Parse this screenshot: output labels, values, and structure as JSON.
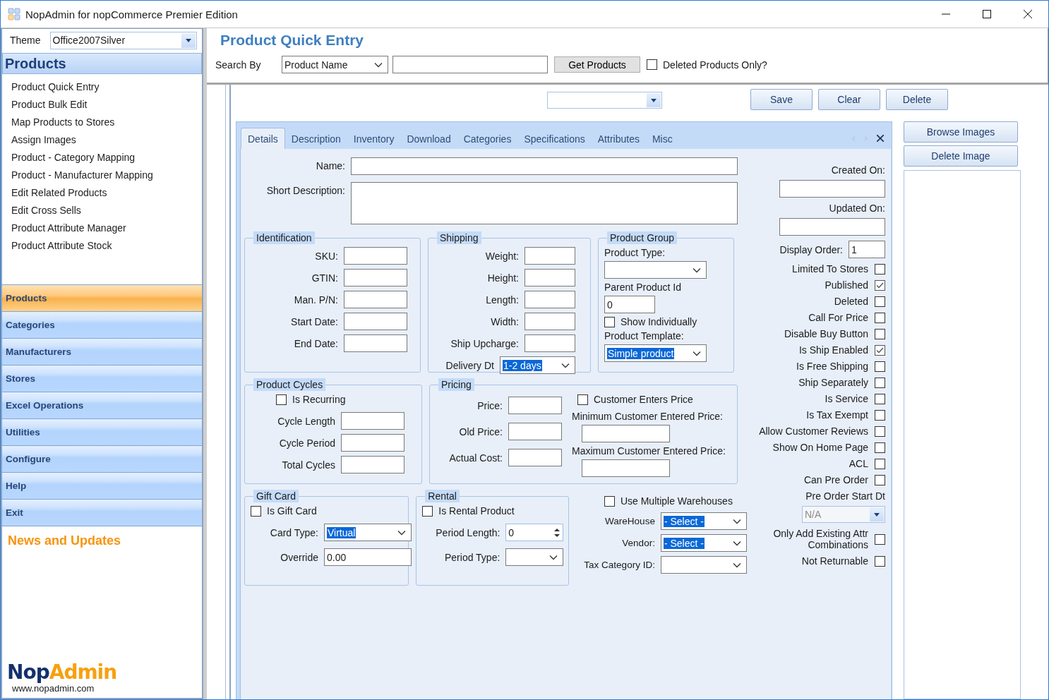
{
  "window": {
    "title": "NopAdmin for nopCommerce Premier Edition"
  },
  "sidebar": {
    "theme_label": "Theme",
    "theme": {
      "kind": "combo",
      "value": "Office2007Silver"
    },
    "section_title": "Products",
    "items": [
      {
        "label": "Product Quick Entry"
      },
      {
        "label": "Product Bulk Edit"
      },
      {
        "label": "Map Products to Stores"
      },
      {
        "label": "Assign Images"
      },
      {
        "label": "Product - Category Mapping"
      },
      {
        "label": "Product - Manufacturer Mapping"
      },
      {
        "label": "Edit Related Products"
      },
      {
        "label": "Edit Cross Sells"
      },
      {
        "label": "Product Attribute Manager"
      },
      {
        "label": "Product Attribute Stock"
      }
    ],
    "nav": [
      {
        "label": "Products",
        "selected": true
      },
      {
        "label": "Categories",
        "selected": false
      },
      {
        "label": "Manufacturers",
        "selected": false
      },
      {
        "label": "Stores",
        "selected": false
      },
      {
        "label": "Excel Operations",
        "selected": false
      },
      {
        "label": "Utilities",
        "selected": false
      },
      {
        "label": "Configure",
        "selected": false
      },
      {
        "label": "Help",
        "selected": false
      },
      {
        "label": "Exit",
        "selected": false
      }
    ],
    "news_title": "News and Updates",
    "logo": {
      "word_parts": [
        "Nop",
        "Admin"
      ],
      "url": "www.nopadmin.com"
    }
  },
  "header": {
    "title": "Product Quick Entry",
    "search_label": "Search By",
    "search_by": {
      "kind": "select",
      "value": "Product Name"
    },
    "search_text": {
      "kind": "text"
    },
    "get_button": "Get Products",
    "deleted_only": {
      "kind": "check",
      "label": "Deleted Products Only?",
      "checked": false
    }
  },
  "toolbar": {
    "selector": {
      "kind": "combo"
    },
    "buttons": [
      "Save",
      "Clear",
      "Delete"
    ]
  },
  "tabs": [
    {
      "label": "Details",
      "selected": true
    },
    {
      "label": "Description",
      "selected": false
    },
    {
      "label": "Inventory",
      "selected": false
    },
    {
      "label": "Download",
      "selected": false
    },
    {
      "label": "Categories",
      "selected": false
    },
    {
      "label": "Specifications",
      "selected": false
    },
    {
      "label": "Attributes",
      "selected": false
    },
    {
      "label": "Misc",
      "selected": false
    }
  ],
  "details": {
    "fields": [
      {
        "kind": "text",
        "label": "Name:",
        "label_above": false
      },
      {
        "kind": "area",
        "label": "Short Description:",
        "label_above": false
      }
    ],
    "group_rows": [
      [
        {
          "kind": "frame",
          "title": "Identification",
          "columns": [
            {
              "fields": [
                {
                  "kind": "text",
                  "label": "SKU:",
                  "label_above": false
                },
                {
                  "kind": "text",
                  "label": "GTIN:",
                  "label_above": false
                },
                {
                  "kind": "text",
                  "label": "Man. P/N:",
                  "label_above": false
                },
                {
                  "kind": "text",
                  "label": "Start Date:",
                  "label_above": false
                },
                {
                  "kind": "text",
                  "label": "End Date:",
                  "label_above": false
                }
              ]
            }
          ]
        },
        {
          "kind": "frame",
          "title": "Shipping",
          "columns": [
            {
              "fields": [
                {
                  "kind": "text",
                  "label": "Weight:",
                  "label_above": false
                },
                {
                  "kind": "text",
                  "label": "Height:",
                  "label_above": false
                },
                {
                  "kind": "text",
                  "label": "Length:",
                  "label_above": false
                },
                {
                  "kind": "text",
                  "label": "Width:",
                  "label_above": false
                },
                {
                  "kind": "text",
                  "label": "Ship Upcharge:",
                  "label_above": false
                },
                {
                  "kind": "select",
                  "label": "Delivery Dt",
                  "label_above": false,
                  "value": "1-2 days",
                  "highlight": true
                }
              ]
            }
          ]
        },
        {
          "kind": "frame",
          "title": "Product Group",
          "columns": [
            {
              "fields": [
                {
                  "kind": "select",
                  "label": "Product Type:",
                  "label_above": true
                },
                {
                  "kind": "text",
                  "label": "Parent Product Id",
                  "label_above": true,
                  "value": "0"
                },
                {
                  "kind": "check",
                  "label": "Show Individually",
                  "checked": false
                },
                {
                  "kind": "select",
                  "label": "Product Template:",
                  "label_above": true,
                  "value": "Simple product",
                  "highlight": true
                }
              ]
            }
          ]
        }
      ],
      [
        {
          "kind": "frame",
          "title": "Product Cycles",
          "columns": [
            {
              "fields": [
                {
                  "kind": "check",
                  "label": "Is Recurring",
                  "checked": false
                },
                {
                  "kind": "text",
                  "label": "Cycle Length",
                  "label_above": false
                },
                {
                  "kind": "text",
                  "label": "Cycle Period",
                  "label_above": false
                },
                {
                  "kind": "text",
                  "label": "Total Cycles",
                  "label_above": false
                }
              ]
            }
          ]
        },
        {
          "kind": "frame",
          "title": "Pricing",
          "columns": [
            {
              "fields": [
                {
                  "kind": "text",
                  "label": "Price:",
                  "label_above": false
                },
                {
                  "kind": "text",
                  "label": "Old Price:",
                  "label_above": false
                },
                {
                  "kind": "text",
                  "label": "Actual Cost:",
                  "label_above": false
                }
              ]
            },
            {
              "fields": [
                {
                  "kind": "check",
                  "label": "Customer Enters Price",
                  "checked": false
                },
                {
                  "kind": "text",
                  "label": "Minimum Customer Entered Price:",
                  "label_above": true
                },
                {
                  "kind": "text",
                  "label": "Maximum Customer Entered Price:",
                  "label_above": true
                }
              ]
            }
          ]
        }
      ],
      [
        {
          "kind": "frame",
          "title": "Gift Card",
          "columns": [
            {
              "fields": [
                {
                  "kind": "check",
                  "label": "Is Gift Card",
                  "checked": false
                },
                {
                  "kind": "select",
                  "label": "Card Type:",
                  "label_above": false,
                  "value": "Virtual",
                  "highlight": true
                },
                {
                  "kind": "text",
                  "label": "Override",
                  "label_above": false,
                  "value": "0.00"
                }
              ]
            }
          ]
        },
        {
          "kind": "frame",
          "title": "Rental",
          "columns": [
            {
              "fields": [
                {
                  "kind": "check",
                  "label": "Is Rental Product",
                  "checked": false
                },
                {
                  "kind": "spin",
                  "label": "Period Length:",
                  "label_above": false,
                  "value": "0"
                },
                {
                  "kind": "select",
                  "label": "Period Type:",
                  "label_above": false
                }
              ]
            }
          ]
        },
        {
          "kind": "plain",
          "columns": [
            {
              "fields": [
                {
                  "kind": "check",
                  "label": "Use Multiple Warehouses",
                  "checked": false
                },
                {
                  "kind": "select",
                  "label": "WareHouse",
                  "label_above": false,
                  "value": "- Select -",
                  "highlight": true
                },
                {
                  "kind": "select",
                  "label": "Vendor:",
                  "label_above": false,
                  "value": "- Select -",
                  "highlight": true
                },
                {
                  "kind": "select",
                  "label": "Tax Category ID:",
                  "label_above": false
                }
              ]
            }
          ]
        }
      ]
    ],
    "side_fields": [
      {
        "kind": "text",
        "label": "Created On:",
        "label_above": true
      },
      {
        "kind": "text",
        "label": "Updated On:",
        "label_above": true
      },
      {
        "kind": "text",
        "label": "Display Order:",
        "label_above": false,
        "value": "1"
      },
      {
        "kind": "check_end",
        "label": "Limited To Stores",
        "checked": false
      },
      {
        "kind": "check_end",
        "label": "Published",
        "checked": true
      },
      {
        "kind": "check_end",
        "label": "Deleted",
        "checked": false
      },
      {
        "kind": "check_end",
        "label": "Call For Price",
        "checked": false
      },
      {
        "kind": "check_end",
        "label": "Disable Buy Button",
        "checked": false
      },
      {
        "kind": "check_end",
        "label": "Is Ship Enabled",
        "checked": true
      },
      {
        "kind": "check_end",
        "label": "Is Free Shipping",
        "checked": false
      },
      {
        "kind": "check_end",
        "label": "Ship Separately",
        "checked": false
      },
      {
        "kind": "check_end",
        "label": "Is Service",
        "checked": false
      },
      {
        "kind": "check_end",
        "label": "Is Tax Exempt",
        "checked": false
      },
      {
        "kind": "check_end",
        "label": "Allow Customer Reviews",
        "checked": false
      },
      {
        "kind": "check_end",
        "label": "Show On Home Page",
        "checked": false
      },
      {
        "kind": "check_end",
        "label": "ACL",
        "checked": false
      },
      {
        "kind": "check_end",
        "label": "Can Pre Order",
        "checked": false
      },
      {
        "kind": "combo",
        "label": "Pre Order Start Dt",
        "label_above": true,
        "value": "N/A",
        "disabled": true
      },
      {
        "kind": "check_end",
        "label": "Only Add Existing Attr Combinations",
        "checked": false
      },
      {
        "kind": "check_end",
        "label": "Not Returnable",
        "checked": false
      }
    ]
  },
  "image_buttons": [
    "Browse Images",
    "Delete Image"
  ]
}
